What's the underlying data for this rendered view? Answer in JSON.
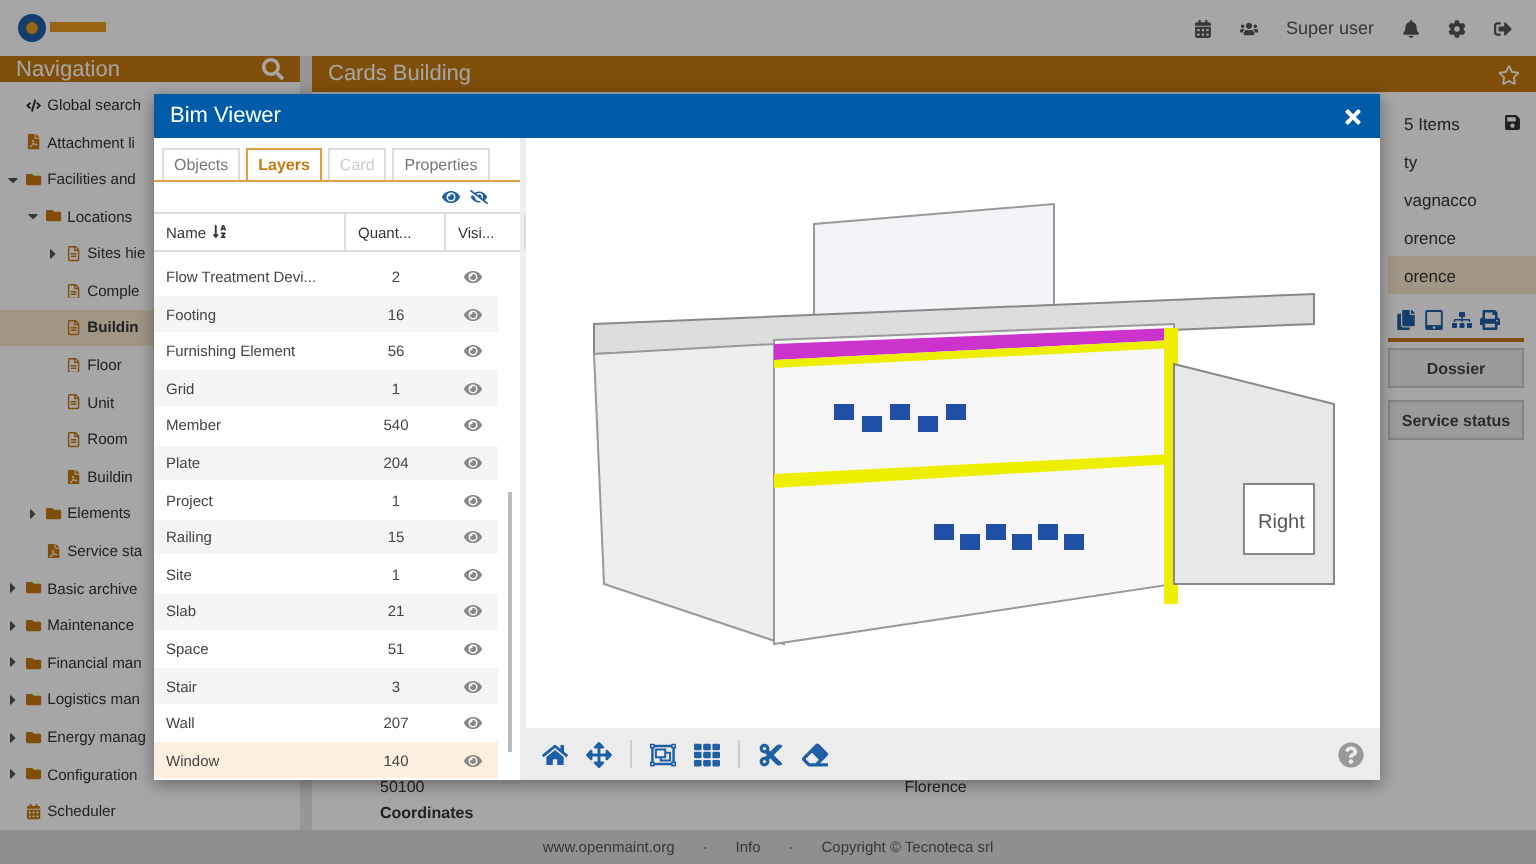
{
  "topbar": {
    "user": "Super user"
  },
  "navigation": {
    "title": "Navigation",
    "items": [
      {
        "label": "Global search",
        "kind": "code",
        "selected": false
      },
      {
        "label": "Attachment li",
        "kind": "pdf",
        "selected": false
      },
      {
        "label": "Facilities and",
        "kind": "folder",
        "expanded": true,
        "selected": false,
        "children": [
          {
            "label": "Locations",
            "kind": "folder",
            "expanded": true,
            "selected": false,
            "children": [
              {
                "label": "Sites hie",
                "kind": "class",
                "expanded": false,
                "selected": false
              },
              {
                "label": "Comple",
                "kind": "class",
                "selected": false
              },
              {
                "label": "Buildin",
                "kind": "class",
                "selected": true
              },
              {
                "label": "Floor",
                "kind": "class",
                "selected": false
              },
              {
                "label": "Unit",
                "kind": "class",
                "selected": false
              },
              {
                "label": "Room",
                "kind": "class",
                "selected": false
              },
              {
                "label": "Buildin",
                "kind": "pdf",
                "selected": false
              }
            ]
          },
          {
            "label": "Elements",
            "kind": "folder",
            "expanded": false,
            "selected": false
          },
          {
            "label": "Service sta",
            "kind": "pdf",
            "selected": false
          }
        ]
      },
      {
        "label": "Basic archive",
        "kind": "folder",
        "expanded": false,
        "selected": false
      },
      {
        "label": "Maintenance",
        "kind": "folder",
        "expanded": false,
        "selected": false
      },
      {
        "label": "Financial man",
        "kind": "folder",
        "expanded": false,
        "selected": false
      },
      {
        "label": "Logistics man",
        "kind": "folder",
        "expanded": false,
        "selected": false
      },
      {
        "label": "Energy manag",
        "kind": "folder",
        "expanded": false,
        "selected": false
      },
      {
        "label": "Configuration",
        "kind": "folder",
        "expanded": false,
        "selected": false
      },
      {
        "label": "Scheduler",
        "kind": "calendar",
        "selected": false
      }
    ]
  },
  "cards": {
    "title": "Cards Building",
    "count": "5 Items",
    "column": "ty",
    "rows": [
      {
        "text": "vagnacco",
        "selected": false
      },
      {
        "text": "orence",
        "selected": false
      },
      {
        "text": "orence",
        "selected": true
      }
    ],
    "buttons": [
      "Dossier",
      "Service status"
    ],
    "details": [
      {
        "text": "50100",
        "kind": "value"
      },
      {
        "text": "Florence",
        "kind": "value"
      },
      {
        "text": "Coordinates",
        "kind": "heading"
      }
    ]
  },
  "dialog": {
    "title": "Bim Viewer",
    "tabs": [
      {
        "label": "Objects",
        "selected": false,
        "disabled": false
      },
      {
        "label": "Layers",
        "selected": true,
        "disabled": false
      },
      {
        "label": "Card",
        "selected": false,
        "disabled": true
      },
      {
        "label": "Properties",
        "selected": false,
        "disabled": false
      }
    ],
    "columns": [
      "Name",
      "Quant...",
      "Visi..."
    ],
    "layers": [
      {
        "name": "Flow Treatment Devi...",
        "quantity": "2",
        "visible": true,
        "selected": false
      },
      {
        "name": "Footing",
        "quantity": "16",
        "visible": true,
        "selected": false
      },
      {
        "name": "Furnishing Element",
        "quantity": "56",
        "visible": true,
        "selected": false
      },
      {
        "name": "Grid",
        "quantity": "1",
        "visible": true,
        "selected": false
      },
      {
        "name": "Member",
        "quantity": "540",
        "visible": true,
        "selected": false
      },
      {
        "name": "Plate",
        "quantity": "204",
        "visible": true,
        "selected": false
      },
      {
        "name": "Project",
        "quantity": "1",
        "visible": true,
        "selected": false
      },
      {
        "name": "Railing",
        "quantity": "15",
        "visible": true,
        "selected": false
      },
      {
        "name": "Site",
        "quantity": "1",
        "visible": true,
        "selected": false
      },
      {
        "name": "Slab",
        "quantity": "21",
        "visible": true,
        "selected": false
      },
      {
        "name": "Space",
        "quantity": "51",
        "visible": true,
        "selected": false
      },
      {
        "name": "Stair",
        "quantity": "3",
        "visible": true,
        "selected": false
      },
      {
        "name": "Wall",
        "quantity": "207",
        "visible": true,
        "selected": false
      },
      {
        "name": "Window",
        "quantity": "140",
        "visible": true,
        "selected": true
      }
    ],
    "sign_text": "Right"
  },
  "footer": [
    "www.openmaint.org",
    "·",
    "Info",
    "·",
    "Copyright © Tecnoteca srl"
  ]
}
